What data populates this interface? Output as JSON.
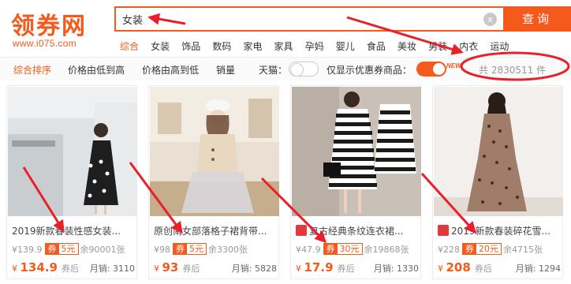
{
  "logo": {
    "name": "领券网",
    "url": "www.i075.com"
  },
  "search": {
    "query": "女装",
    "clear_symbol": "x",
    "button_label": "查询"
  },
  "categories": [
    "综合",
    "女装",
    "饰品",
    "数码",
    "家电",
    "家具",
    "孕妈",
    "婴儿",
    "食品",
    "美妆",
    "男装",
    "内衣",
    "运动"
  ],
  "filters": {
    "sort_overall": "综合排序",
    "sort_price_asc_1": "价格",
    "sort_price_asc_2": "由",
    "sort_price_asc_3": "低到高",
    "sort_price_desc_1": "价格",
    "sort_price_desc_2": "由",
    "sort_price_desc_3": "高到低",
    "sort_sales": "销量",
    "tmall_label": "天猫：",
    "coupon_only_label": "仅显示优惠券商品：",
    "new_badge": "NEW",
    "total": "共 2830511 件"
  },
  "products": [
    {
      "title": "2019新款春装性感女装...",
      "tmall": false,
      "orig_price": "¥139.9",
      "coupon_label": "券",
      "coupon_value": "5元",
      "remaining": "余90001张",
      "price_symbol": "¥",
      "price": "134.9",
      "after": "券后",
      "sales": "月销: 3110"
    },
    {
      "title": "原创南女部落格子裙背带...",
      "tmall": false,
      "orig_price": "¥98",
      "coupon_label": "券",
      "coupon_value": "5元",
      "remaining": "余3300张",
      "price_symbol": "¥",
      "price": "93",
      "after": "券后",
      "sales": "月销: 5828"
    },
    {
      "title": "复古经典条纹连衣裙...",
      "tmall": true,
      "orig_price": "¥47.9",
      "coupon_label": "券",
      "coupon_value": "30元",
      "remaining": "余19868张",
      "price_symbol": "¥",
      "price": "17.9",
      "after": "券后",
      "sales": "月销: 1330"
    },
    {
      "title": "2019新款春装碎花雪...",
      "tmall": true,
      "orig_price": "¥228",
      "coupon_label": "券",
      "coupon_value": "20元",
      "remaining": "余4715张",
      "price_symbol": "¥",
      "price": "208",
      "after": "券后",
      "sales": "月销: 1294"
    }
  ],
  "colors": {
    "accent": "#f35a1c",
    "annotation": "#e8202a"
  }
}
